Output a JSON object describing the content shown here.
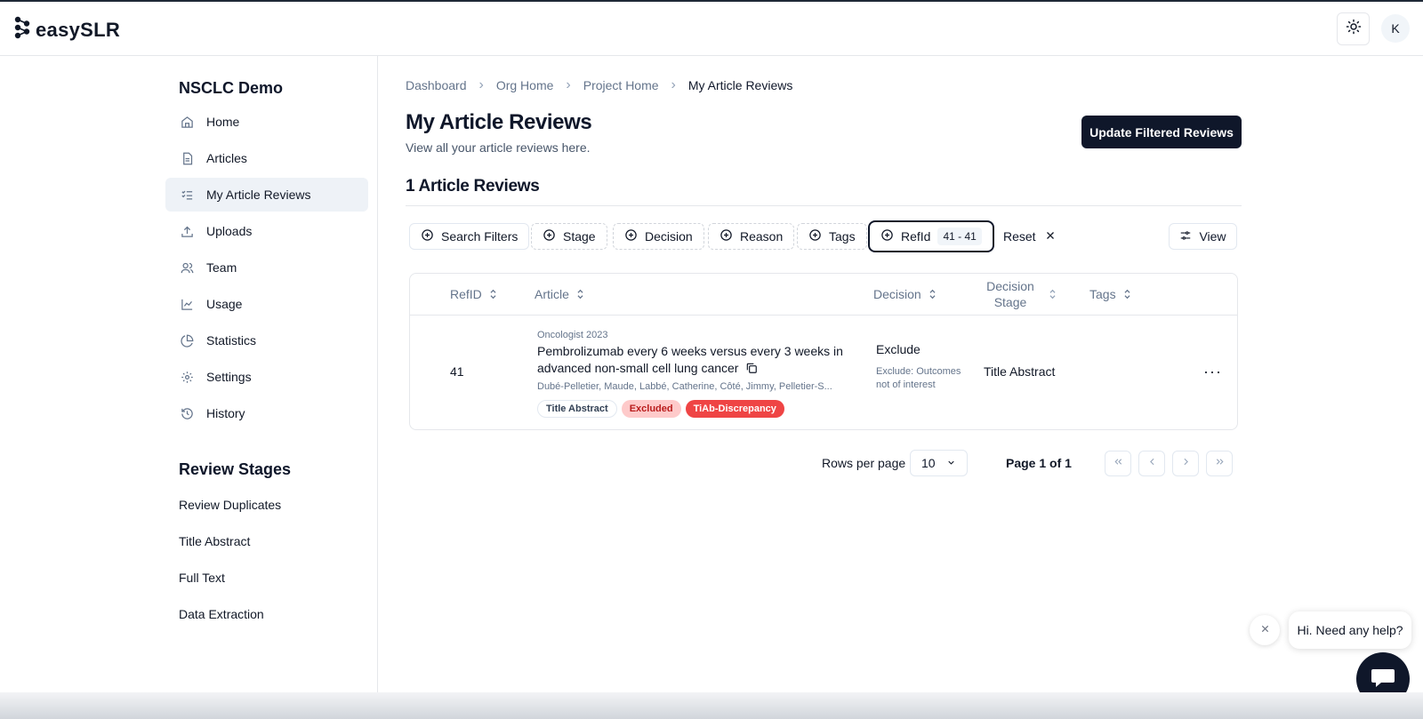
{
  "app": {
    "logo_text": "easySLR",
    "avatar_initial": "K"
  },
  "sidebar": {
    "project_title": "NSCLC Demo",
    "items": [
      {
        "label": "Home",
        "icon": "home-icon"
      },
      {
        "label": "Articles",
        "icon": "document-icon"
      },
      {
        "label": "My Article Reviews",
        "icon": "checklist-icon",
        "active": true
      },
      {
        "label": "Uploads",
        "icon": "upload-icon"
      },
      {
        "label": "Team",
        "icon": "users-icon"
      },
      {
        "label": "Usage",
        "icon": "line-chart-icon"
      },
      {
        "label": "Statistics",
        "icon": "pie-chart-icon"
      },
      {
        "label": "Settings",
        "icon": "gear-icon"
      },
      {
        "label": "History",
        "icon": "history-icon"
      }
    ],
    "stages_title": "Review Stages",
    "stages": [
      "Review Duplicates",
      "Title Abstract",
      "Full Text",
      "Data Extraction"
    ]
  },
  "breadcrumb": [
    "Dashboard",
    "Org Home",
    "Project Home",
    "My Article Reviews"
  ],
  "page": {
    "title": "My Article Reviews",
    "subtitle": "View all your article reviews here.",
    "update_button": "Update Filtered Reviews",
    "count_title": "1 Article Reviews"
  },
  "filters": {
    "buttons": [
      "Search Filters",
      "Stage",
      "Decision",
      "Reason",
      "Tags"
    ],
    "refid_label": "RefId",
    "refid_range": "41 - 41",
    "reset_label": "Reset",
    "view_label": "View"
  },
  "table": {
    "columns": [
      "RefID",
      "Article",
      "Decision",
      "Decision Stage",
      "Tags"
    ],
    "rows": [
      {
        "refid": "41",
        "meta": "Oncologist 2023",
        "title": "Pembrolizumab every 6 weeks versus every 3 weeks in advanced non-small cell lung cancer",
        "authors": "Dubé-Pelletier, Maude, Labbé, Catherine, Côté, Jimmy, Pelletier-S...",
        "tags": [
          "Title Abstract",
          "Excluded",
          "TiAb-Discrepancy"
        ],
        "decision": "Exclude",
        "decision_reason": "Exclude: Outcomes not of interest",
        "decision_stage": "Title Abstract",
        "more": "···"
      }
    ]
  },
  "pagination": {
    "rows_per_page_label": "Rows per page",
    "rows_per_page_value": "10",
    "page_info": "Page 1 of 1"
  },
  "help": {
    "bubble_text": "Hi. Need any help?"
  },
  "colors": {
    "primary": "#0f172a",
    "danger": "#ef4444",
    "danger_soft": "#fecaca",
    "active_nav": "#eef2f7"
  }
}
